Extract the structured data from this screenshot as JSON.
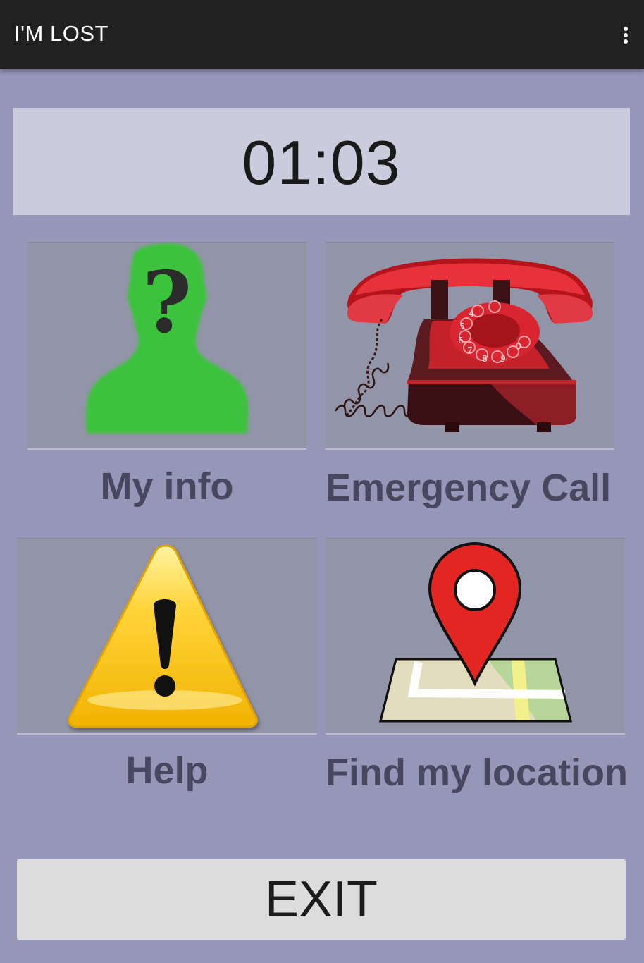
{
  "app_bar": {
    "title": "I'M LOST",
    "overflow_icon": "more-vertical-icon"
  },
  "timer": {
    "value": "01:03"
  },
  "tiles": [
    {
      "label": "My info",
      "icon": "person-question-icon"
    },
    {
      "label": "Emergency Call",
      "icon": "rotary-phone-icon"
    },
    {
      "label": "Help",
      "icon": "warning-icon"
    },
    {
      "label": "Find my location",
      "icon": "map-pin-icon"
    }
  ],
  "exit_button": {
    "label": "EXIT"
  },
  "colors": {
    "background": "#9596b8",
    "action_bar": "#212121",
    "tile": "#9294a8",
    "label": "#474860",
    "timer_box": "#cacbdd",
    "exit_button": "#dcdcdc"
  }
}
